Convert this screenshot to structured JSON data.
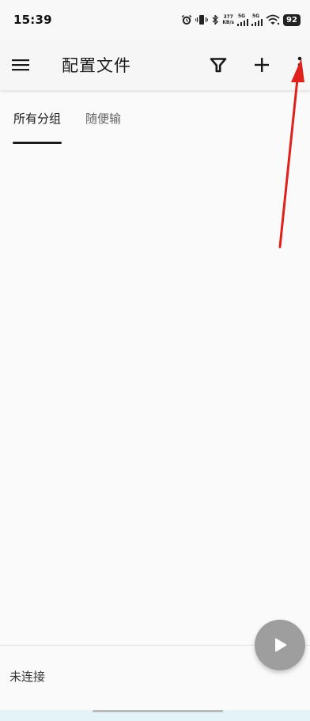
{
  "status_bar": {
    "time": "15:39",
    "net_speed_value": "377",
    "net_speed_unit": "KB/s",
    "signal1_label": "5G",
    "signal2_label": "5G",
    "battery": "92"
  },
  "app_bar": {
    "title": "配置文件",
    "icons": [
      "menu-icon",
      "filter-icon",
      "add-icon",
      "more-vert-icon"
    ]
  },
  "tabs": [
    {
      "label": "所有分组",
      "active": true
    },
    {
      "label": "随便输",
      "active": false
    }
  ],
  "connection": {
    "status_text": "未连接"
  },
  "fab": {
    "icon": "play-icon"
  },
  "colors": {
    "background": "#fafafa",
    "app_bar": "#f6f6f6",
    "fab": "#9e9e9e",
    "annotation_arrow": "#e0201b",
    "text": "#1a1a1a"
  }
}
